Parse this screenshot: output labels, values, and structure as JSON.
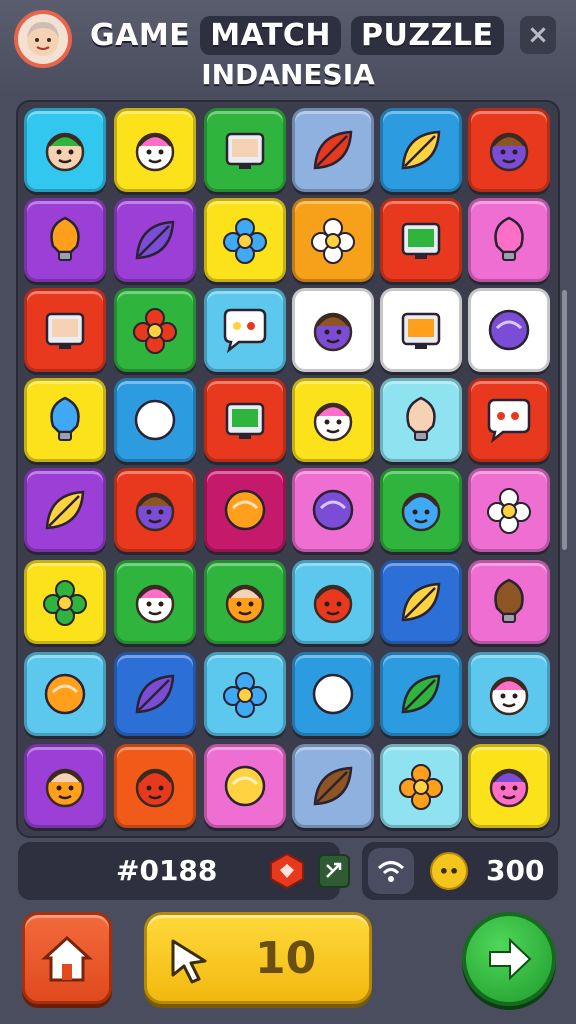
{
  "header": {
    "title_words": [
      "GAME",
      "MATCH",
      "PUZZLE"
    ],
    "subtitle": "INDANESIA",
    "close_glyph": "×"
  },
  "board": {
    "rows": 8,
    "cols": 6,
    "tiles": [
      [
        "#31c7ef",
        "boy-face-icon"
      ],
      [
        "#fbe21a",
        "lion-face-icon"
      ],
      [
        "#2fb53d",
        "house-icon"
      ],
      [
        "#8fb1df",
        "leaf-icon"
      ],
      [
        "#2c9be0",
        "feather-icon"
      ],
      [
        "#e8391e",
        "monster-face-icon"
      ],
      [
        "#9b3fd6",
        "bottle-icon"
      ],
      [
        "#9b3fd6",
        "pencil-icon"
      ],
      [
        "#fbe21a",
        "heart-flower-icon"
      ],
      [
        "#f7a01a",
        "bell-flower-icon"
      ],
      [
        "#e8391e",
        "phone-icon"
      ],
      [
        "#ee6ed1",
        "light-bulb-icon"
      ],
      [
        "#e8391e",
        "monitor-icon"
      ],
      [
        "#2fb53d",
        "sunflower-icon"
      ],
      [
        "#5cc8ee",
        "chat-bubble-icon"
      ],
      [
        "#ffffff",
        "red-face-icon"
      ],
      [
        "#ffffff",
        "picture-frame-icon"
      ],
      [
        "#ffffff",
        "red-ball-icon"
      ],
      [
        "#fbe21a",
        "lamp-icon"
      ],
      [
        "#2c9be0",
        "ghost-icon"
      ],
      [
        "#e8391e",
        "framed-map-icon"
      ],
      [
        "#fbe21a",
        "girl-face-icon"
      ],
      [
        "#8fe3f0",
        "green-balloon-icon"
      ],
      [
        "#e8391e",
        "speech-bubble-icon"
      ],
      [
        "#9b3fd6",
        "yellow-leaf-icon"
      ],
      [
        "#e8391e",
        "bear-face-icon"
      ],
      [
        "#c5196b",
        "green-monster-icon"
      ],
      [
        "#ee6ed1",
        "mushroom-icon"
      ],
      [
        "#2fb53d",
        "acorn-face-icon"
      ],
      [
        "#ee6ed1",
        "sun-badge-icon"
      ],
      [
        "#fbe21a",
        "tulip-icon"
      ],
      [
        "#2fb53d",
        "cat-face-icon"
      ],
      [
        "#2fb53d",
        "dog-face-icon"
      ],
      [
        "#5cc8ee",
        "smile-face-icon"
      ],
      [
        "#2c6fd6",
        "seashell-icon"
      ],
      [
        "#ee6ed1",
        "red-drop-icon"
      ],
      [
        "#5cc8ee",
        "ice-cream-icon"
      ],
      [
        "#2c6fd6",
        "crayon-icon"
      ],
      [
        "#5cc8ee",
        "pink-flower-icon"
      ],
      [
        "#2c9be0",
        "cherry-icon"
      ],
      [
        "#2c9be0",
        "arrow-leaf-icon"
      ],
      [
        "#5cc8ee",
        "mask-face-icon"
      ],
      [
        "#9b3fd6",
        "fox-face-icon"
      ],
      [
        "#f25a1a",
        "cat-head-icon"
      ],
      [
        "#ee6ed1",
        "fox-arrow-icon"
      ],
      [
        "#8fb1df",
        "blue-leaf-icon"
      ],
      [
        "#8fe3f0",
        "lotus-icon"
      ],
      [
        "#fbe21a",
        "man-face-icon"
      ]
    ]
  },
  "status": {
    "level": "#0188",
    "coins": "300",
    "coin_glyph": "••"
  },
  "controls": {
    "hints": "10"
  }
}
